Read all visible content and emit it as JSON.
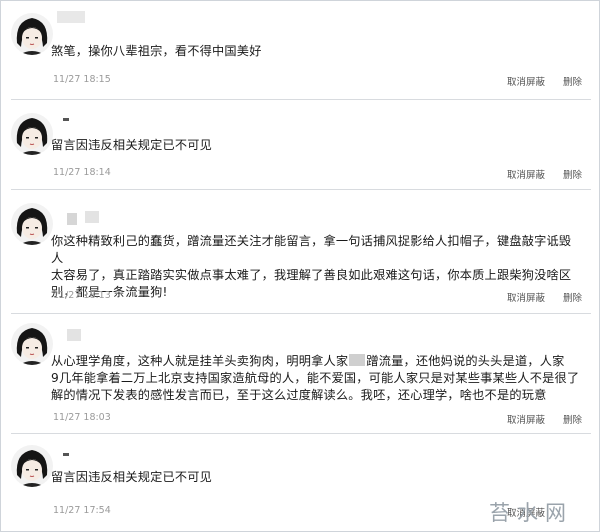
{
  "comments": [
    {
      "text": "煞笔，操你八辈祖宗，看不得中国美好",
      "time": "11/27 18:15",
      "cancel_label": "取消屏蔽",
      "delete_label": "删除"
    },
    {
      "text": "留言因违反相关规定已不可见",
      "time": "11/27 18:14",
      "cancel_label": "取消屏蔽",
      "delete_label": "删除"
    },
    {
      "text_line1": "你这种精致利己的蠢货，蹭流量还关注才能留言，拿一句话捕风捉影给人扣帽子，键盘敲字诋毁人",
      "text_line2": "太容易了，真正踏踏实实做点事太难了，我理解了善良如此艰难这句话，你本质上跟柴狗没啥区",
      "text_line3": "别，都是一条流量狗!",
      "time": "11/27 18:13",
      "cancel_label": "取消屏蔽",
      "delete_label": "删除"
    },
    {
      "text_line1a": "从心理学角度，这种人就是挂羊头卖狗肉，明明拿人家",
      "text_line1b": "蹭流量，还他妈说的头头是道，人家",
      "text_line2a": "9几年能拿着二万上北京支持国家造航母的人，能不爱国，",
      "text_line2b": "可能人家只是对某些事某些人不是很了",
      "text_line3": "解的情况下发表的感性发言而已，至于这么过度解读么。我呸，还心理学，啥也不是的玩意",
      "time": "11/27 18:03",
      "cancel_label": "取消屏蔽",
      "delete_label": "删除"
    },
    {
      "text": "留言因违反相关规定已不可见",
      "time": "11/27 17:54",
      "cancel_label": "取消屏蔽",
      "delete_label": "删除"
    }
  ],
  "watermark": "苔水网",
  "colors": {
    "text": "#1a1a1a",
    "meta": "#9a9a9a",
    "action": "#555555",
    "divider": "#d8dbdf"
  }
}
